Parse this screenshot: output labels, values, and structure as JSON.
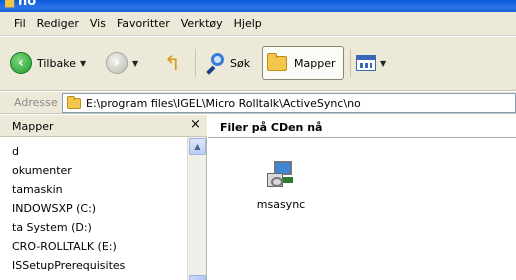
{
  "window": {
    "title": "no"
  },
  "menubar": {
    "items": [
      "Fil",
      "Rediger",
      "Vis",
      "Favoritter",
      "Verktøy",
      "Hjelp"
    ]
  },
  "toolbar": {
    "back_label": "Tilbake",
    "search_label": "Søk",
    "folders_label": "Mapper"
  },
  "address": {
    "label": "Adresse",
    "path": "E:\\program files\\IGEL\\Micro Rolltalk\\ActiveSync\\no"
  },
  "left_pane": {
    "title": "Mapper",
    "close_glyph": "×",
    "tree": [
      "d",
      "okumenter",
      "tamaskin",
      "INDOWSXP (C:)",
      "ta System (D:)",
      "CRO-ROLLTALK (E:)",
      "ISSetupPrerequisites"
    ]
  },
  "content": {
    "header": "Filer på CDen nå",
    "files": [
      {
        "name": "msasync"
      }
    ]
  }
}
